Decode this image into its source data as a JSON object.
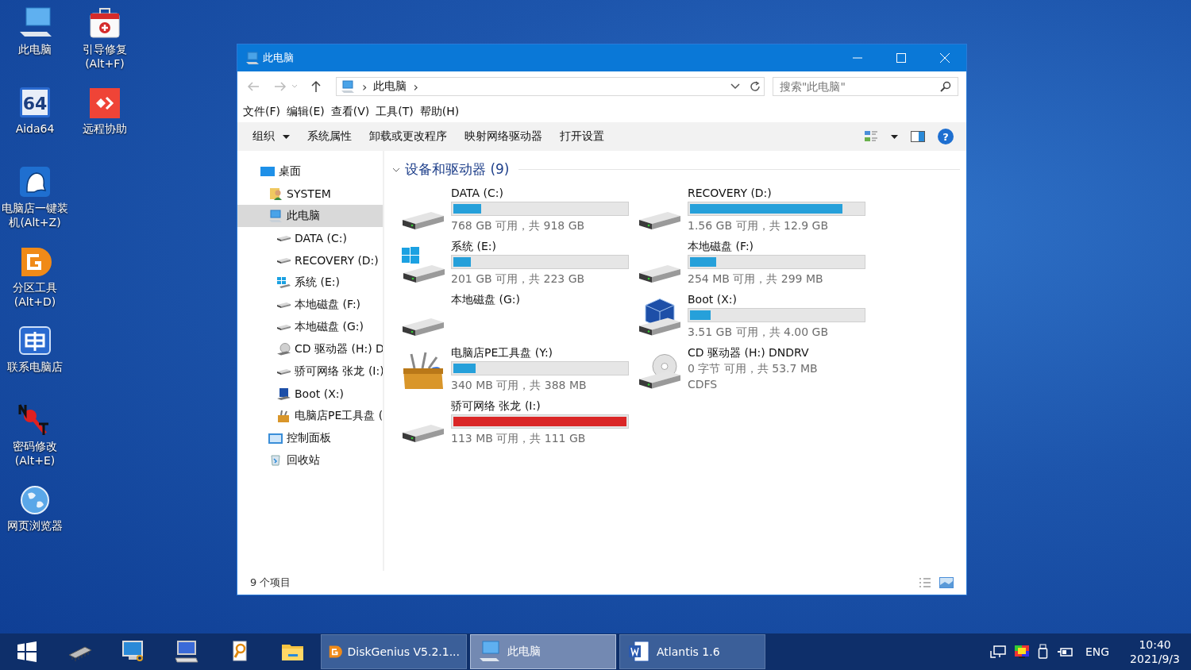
{
  "desktop_icons": [
    {
      "kind": "pc",
      "label": "此电脑"
    },
    {
      "kind": "aida",
      "label": "Aida64",
      "icon_text": "64"
    },
    {
      "kind": "ghost",
      "label": "电脑店一键装机(Alt+Z)"
    },
    {
      "kind": "diskgenius",
      "label": "分区工具(Alt+D)"
    },
    {
      "kind": "contact",
      "label": "联系电脑店"
    },
    {
      "kind": "password",
      "label": "密码修改(Alt+E)"
    },
    {
      "kind": "globe",
      "label": "网页浏览器"
    },
    {
      "kind": "firstaid",
      "label": "引导修复(Alt+F)"
    },
    {
      "kind": "remote",
      "label": "远程协助"
    }
  ],
  "window": {
    "title": "此电脑",
    "address": {
      "parts": [
        {
          "kind": "separator",
          "text": "›"
        },
        {
          "kind": "crumb",
          "text": "此电脑"
        },
        {
          "kind": "separator",
          "text": "›"
        }
      ]
    },
    "search": {
      "placeholder": "搜索\"此电脑\""
    },
    "menu": [
      "文件(F)",
      "编辑(E)",
      "查看(V)",
      "工具(T)",
      "帮助(H)"
    ],
    "commands": [
      {
        "label": "组织",
        "dropdown": true
      },
      {
        "label": "系统属性",
        "dropdown": false
      },
      {
        "label": "卸载或更改程序",
        "dropdown": false
      },
      {
        "label": "映射网络驱动器",
        "dropdown": false
      },
      {
        "label": "打开设置",
        "dropdown": false
      }
    ],
    "help_button": {
      "glyph": "?"
    },
    "nav": [
      {
        "label": "桌面",
        "kind": "desktop",
        "selected": false,
        "children": [
          {
            "label": "SYSTEM",
            "kind": "user",
            "selected": false
          },
          {
            "label": "此电脑",
            "kind": "pc",
            "selected": true,
            "children": [
              {
                "label": "DATA (C:)",
                "kind": "hdd",
                "selected": false
              },
              {
                "label": "RECOVERY (D:)",
                "kind": "hdd",
                "selected": false
              },
              {
                "label": "系统 (E:)",
                "kind": "windows",
                "selected": false
              },
              {
                "label": "本地磁盘 (F:)",
                "kind": "hdd",
                "selected": false
              },
              {
                "label": "本地磁盘 (G:)",
                "kind": "hdd",
                "selected": false
              },
              {
                "label": "CD 驱动器 (H:) D",
                "kind": "cd",
                "selected": false
              },
              {
                "label": "骄可网络 张龙 (I:)",
                "kind": "hdd",
                "selected": false
              },
              {
                "label": "Boot (X:)",
                "kind": "boot",
                "selected": false
              },
              {
                "label": "电脑店PE工具盘 (",
                "kind": "tools",
                "selected": false
              }
            ]
          },
          {
            "label": "控制面板",
            "kind": "control",
            "selected": false
          },
          {
            "label": "回收站",
            "kind": "recycle",
            "selected": false
          }
        ]
      }
    ],
    "group": {
      "title": "设备和驱动器 (9)",
      "expanded": true
    },
    "drives": [
      {
        "name": "DATA (C:)",
        "kind": "hdd",
        "level": 0.16,
        "critical": false,
        "details": [
          "768 GB 可用，共 918 GB"
        ]
      },
      {
        "name": "RECOVERY (D:)",
        "kind": "hdd",
        "level": 0.88,
        "critical": false,
        "details": [
          "1.56 GB 可用，共 12.9 GB"
        ]
      },
      {
        "name": "系统 (E:)",
        "kind": "windows",
        "level": 0.1,
        "critical": false,
        "details": [
          "201 GB 可用，共 223 GB"
        ]
      },
      {
        "name": "本地磁盘 (F:)",
        "kind": "hdd",
        "level": 0.15,
        "critical": false,
        "details": [
          "254 MB 可用，共 299 MB"
        ]
      },
      {
        "name": "本地磁盘 (G:)",
        "kind": "hdd"
      },
      {
        "name": "Boot (X:)",
        "kind": "boot",
        "level": 0.12,
        "critical": false,
        "details": [
          "3.51 GB 可用，共 4.00 GB"
        ]
      },
      {
        "name": "电脑店PE工具盘 (Y:)",
        "kind": "tools",
        "level": 0.13,
        "critical": false,
        "details": [
          "340 MB 可用，共 388 MB"
        ]
      },
      {
        "name": "CD 驱动器 (H:) DNDRV",
        "kind": "cd",
        "details": [
          "0 字节 可用，共 53.7 MB",
          "CDFS"
        ]
      },
      {
        "name": "骄可网络 张龙 (I:)",
        "kind": "hdd",
        "level": 1,
        "critical": true,
        "details": [
          "113 MB 可用，共 111 GB"
        ]
      }
    ],
    "status_bar": {
      "item_count": "9 个项目"
    }
  },
  "taskbar": {
    "pinned": [
      {
        "kind": "start"
      },
      {
        "kind": "chip"
      },
      {
        "kind": "pcedit"
      },
      {
        "kind": "monitor"
      },
      {
        "kind": "search-doc"
      },
      {
        "kind": "folder"
      }
    ],
    "tasks": [
      {
        "kind": "diskgenius",
        "label": "DiskGenius V5.2.1...",
        "selected": false
      },
      {
        "kind": "pc",
        "label": "此电脑",
        "selected": true
      },
      {
        "kind": "word",
        "label": "Atlantis 1.6",
        "selected": false
      }
    ],
    "tray": {
      "language": "ENG",
      "time": "10:40",
      "date": "2021/9/3"
    }
  }
}
